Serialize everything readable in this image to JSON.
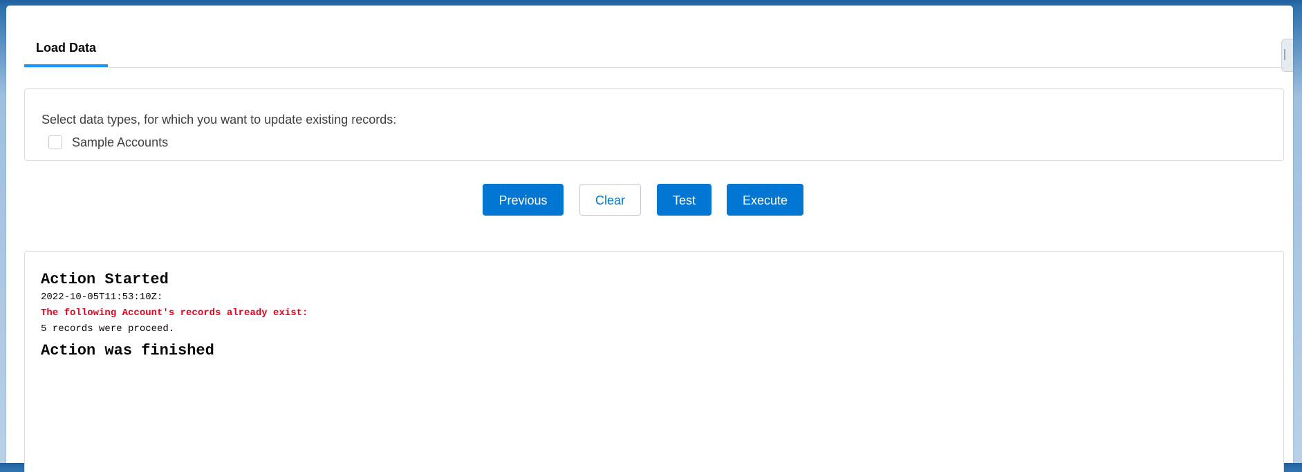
{
  "tabs": [
    {
      "label": "Load Data"
    }
  ],
  "select_section": {
    "prompt": "Select data types, for which you want to update existing records:",
    "options": [
      {
        "label": "Sample Accounts",
        "checked": false
      }
    ]
  },
  "buttons": {
    "previous": "Previous",
    "clear": "Clear",
    "test": "Test",
    "execute": "Execute"
  },
  "log": {
    "started": "Action Started",
    "timestamp": "2022-10-05T11:53:10Z:",
    "error": "The following Account's records already exist:",
    "summary": "5 records were proceed.",
    "finished": "Action was finished"
  },
  "colors": {
    "brand": "#0176d3",
    "tab_indicator": "#1b96ff",
    "error": "#ea001e"
  }
}
